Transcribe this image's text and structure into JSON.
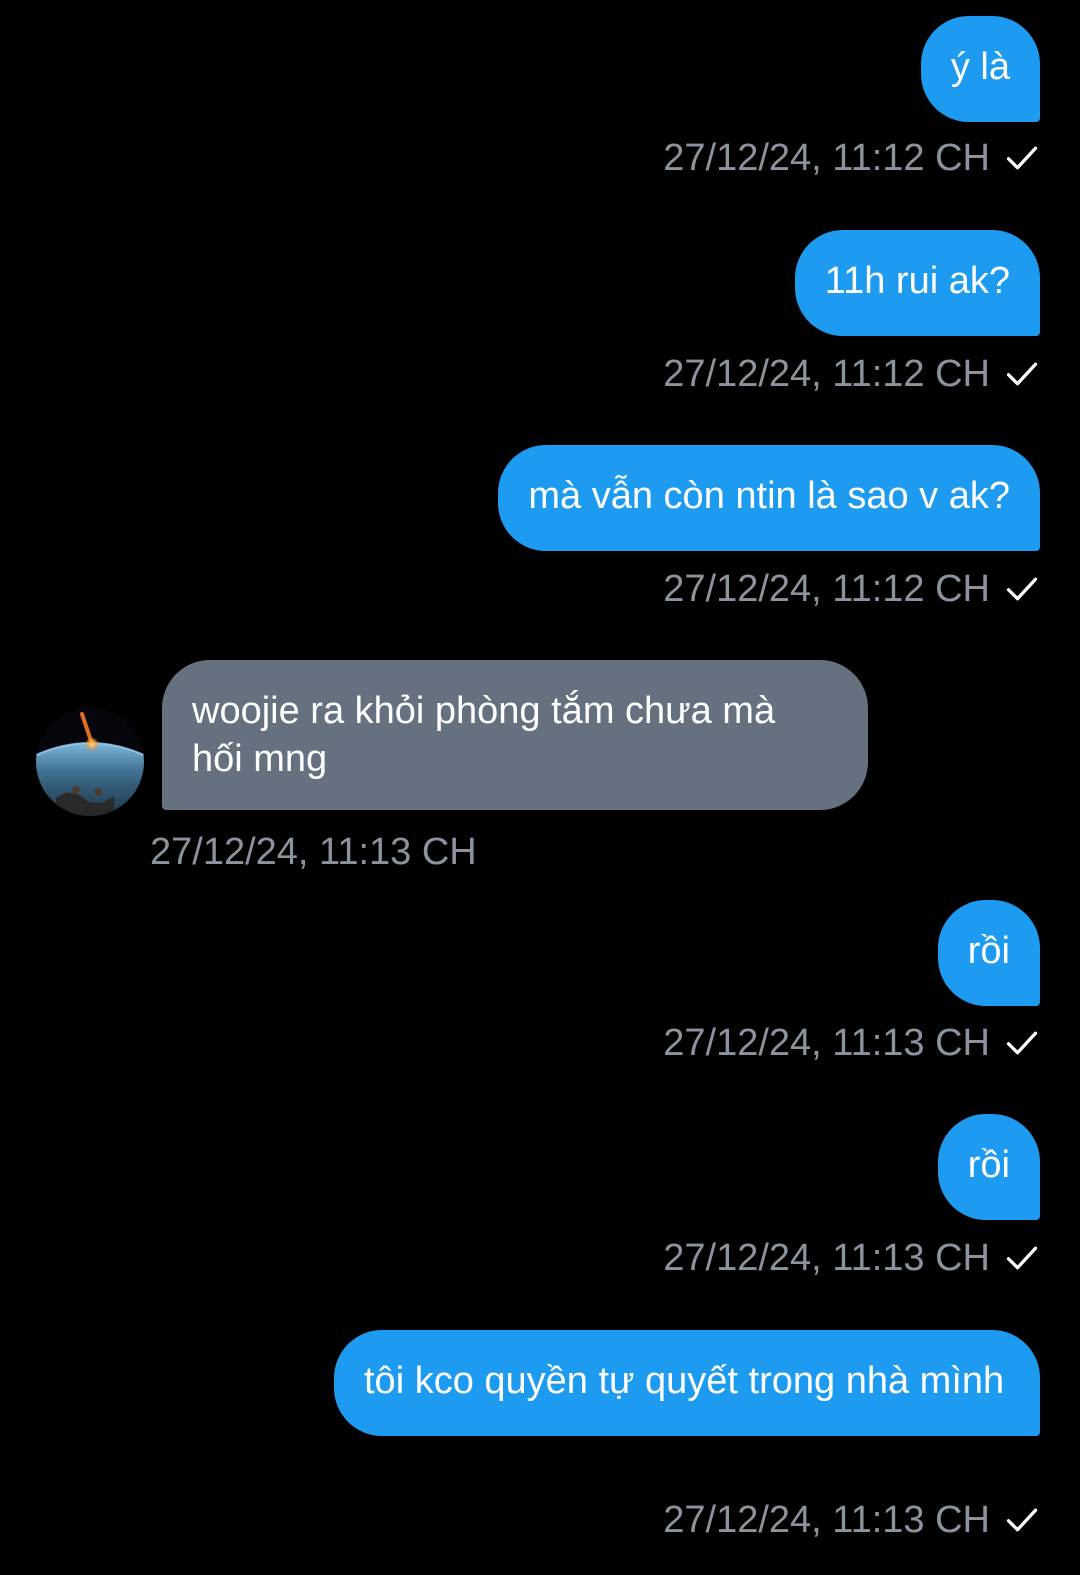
{
  "colors": {
    "background": "#000000",
    "outgoing_bubble": "#1d9bf0",
    "incoming_bubble": "#65717f",
    "timestamp": "#8b949e",
    "read_check": "#ffffff"
  },
  "messages": [
    {
      "direction": "outgoing",
      "text": "ý là",
      "time": "27/12/24, 11:12 CH",
      "status_icon": "check-icon"
    },
    {
      "direction": "outgoing",
      "text": "11h rui ak?",
      "time": "27/12/24, 11:12 CH",
      "status_icon": "check-icon"
    },
    {
      "direction": "outgoing",
      "text": "mà vẫn còn ntin là sao v ak?",
      "time": "27/12/24, 11:12 CH",
      "status_icon": "check-icon"
    },
    {
      "direction": "incoming",
      "text": "woojie ra khỏi phòng tắm chưa mà hối mng",
      "time": "27/12/24, 11:13 CH",
      "avatar": "earth-meteor-avatar"
    },
    {
      "direction": "outgoing",
      "text": "rồi",
      "time": "27/12/24, 11:13 CH",
      "status_icon": "check-icon"
    },
    {
      "direction": "outgoing",
      "text": "rồi",
      "time": "27/12/24, 11:13 CH",
      "status_icon": "check-icon"
    },
    {
      "direction": "outgoing",
      "text": "tôi kco quyền tự quyết trong nhà mình",
      "time": "27/12/24, 11:13 CH",
      "status_icon": "check-icon"
    }
  ]
}
